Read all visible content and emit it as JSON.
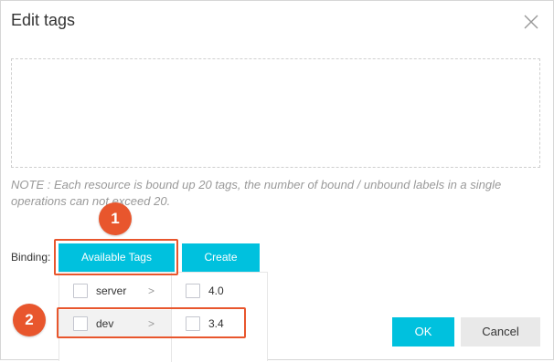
{
  "dialog": {
    "title": "Edit tags",
    "close_icon": "close-icon",
    "note": "NOTE : Each resource is bound up 20 tags, the number of bound / unbound labels in a single operations can not exceed 20."
  },
  "binding": {
    "label": "Binding:",
    "available_tags_label": "Available Tags",
    "create_label": "Create"
  },
  "dropdown": {
    "keys": [
      {
        "label": "server",
        "chevron": ">"
      },
      {
        "label": "dev",
        "chevron": ">"
      }
    ],
    "values": [
      {
        "label": "4.0"
      },
      {
        "label": "3.4"
      }
    ]
  },
  "annotations": {
    "badge_1": "1",
    "badge_2": "2",
    "highlight_color": "#e8562d"
  },
  "footer": {
    "ok_label": "OK",
    "cancel_label": "Cancel"
  },
  "colors": {
    "primary": "#00c1de",
    "secondary_button": "#e9e9e9"
  }
}
